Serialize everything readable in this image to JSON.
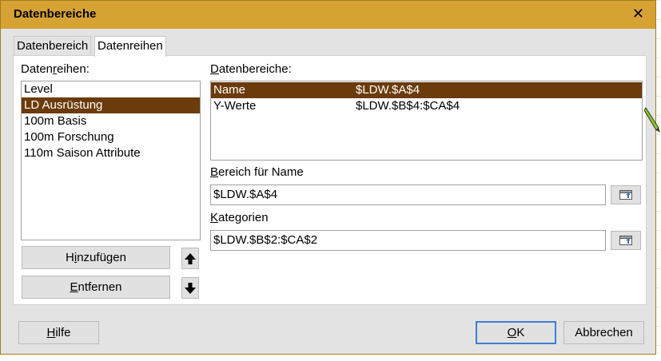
{
  "window": {
    "title": "Datenbereiche"
  },
  "tabs": [
    {
      "label": "Datenbereich",
      "active": false
    },
    {
      "label": "Datenreihen",
      "active": true
    }
  ],
  "series_panel": {
    "label_pre": "Daten",
    "label_accel": "r",
    "label_post": "eihen:",
    "items": [
      {
        "label": "Level",
        "selected": false
      },
      {
        "label": "LD Ausrüstung",
        "selected": true
      },
      {
        "label": "100m Basis",
        "selected": false
      },
      {
        "label": "100m Forschung",
        "selected": false
      },
      {
        "label": "110m Saison Attribute",
        "selected": false
      }
    ],
    "add_pre": "H",
    "add_accel": "i",
    "add_post": "nzufügen",
    "remove_accel": "E",
    "remove_post": "ntfernen"
  },
  "ranges_panel": {
    "label_accel": "D",
    "label_post": "atenbereiche:",
    "rows": [
      {
        "name": "Name",
        "value": "$LDW.$A$4",
        "selected": true
      },
      {
        "name": "Y-Werte",
        "value": "$LDW.$B$4:$CA$4",
        "selected": false
      }
    ]
  },
  "name_range": {
    "label_accel": "B",
    "label_post": "ereich für Name",
    "value": "$LDW.$A$4"
  },
  "categories": {
    "label_accel": "K",
    "label_post": "ategorien",
    "value": "$LDW.$B$2:$CA$2"
  },
  "footer": {
    "help_accel": "H",
    "help_post": "ilfe",
    "ok_accel": "O",
    "ok_post": "K",
    "cancel": "Abbrechen"
  },
  "colors": {
    "title_bar": "#d6a233",
    "selection": "#6b3b0b"
  }
}
